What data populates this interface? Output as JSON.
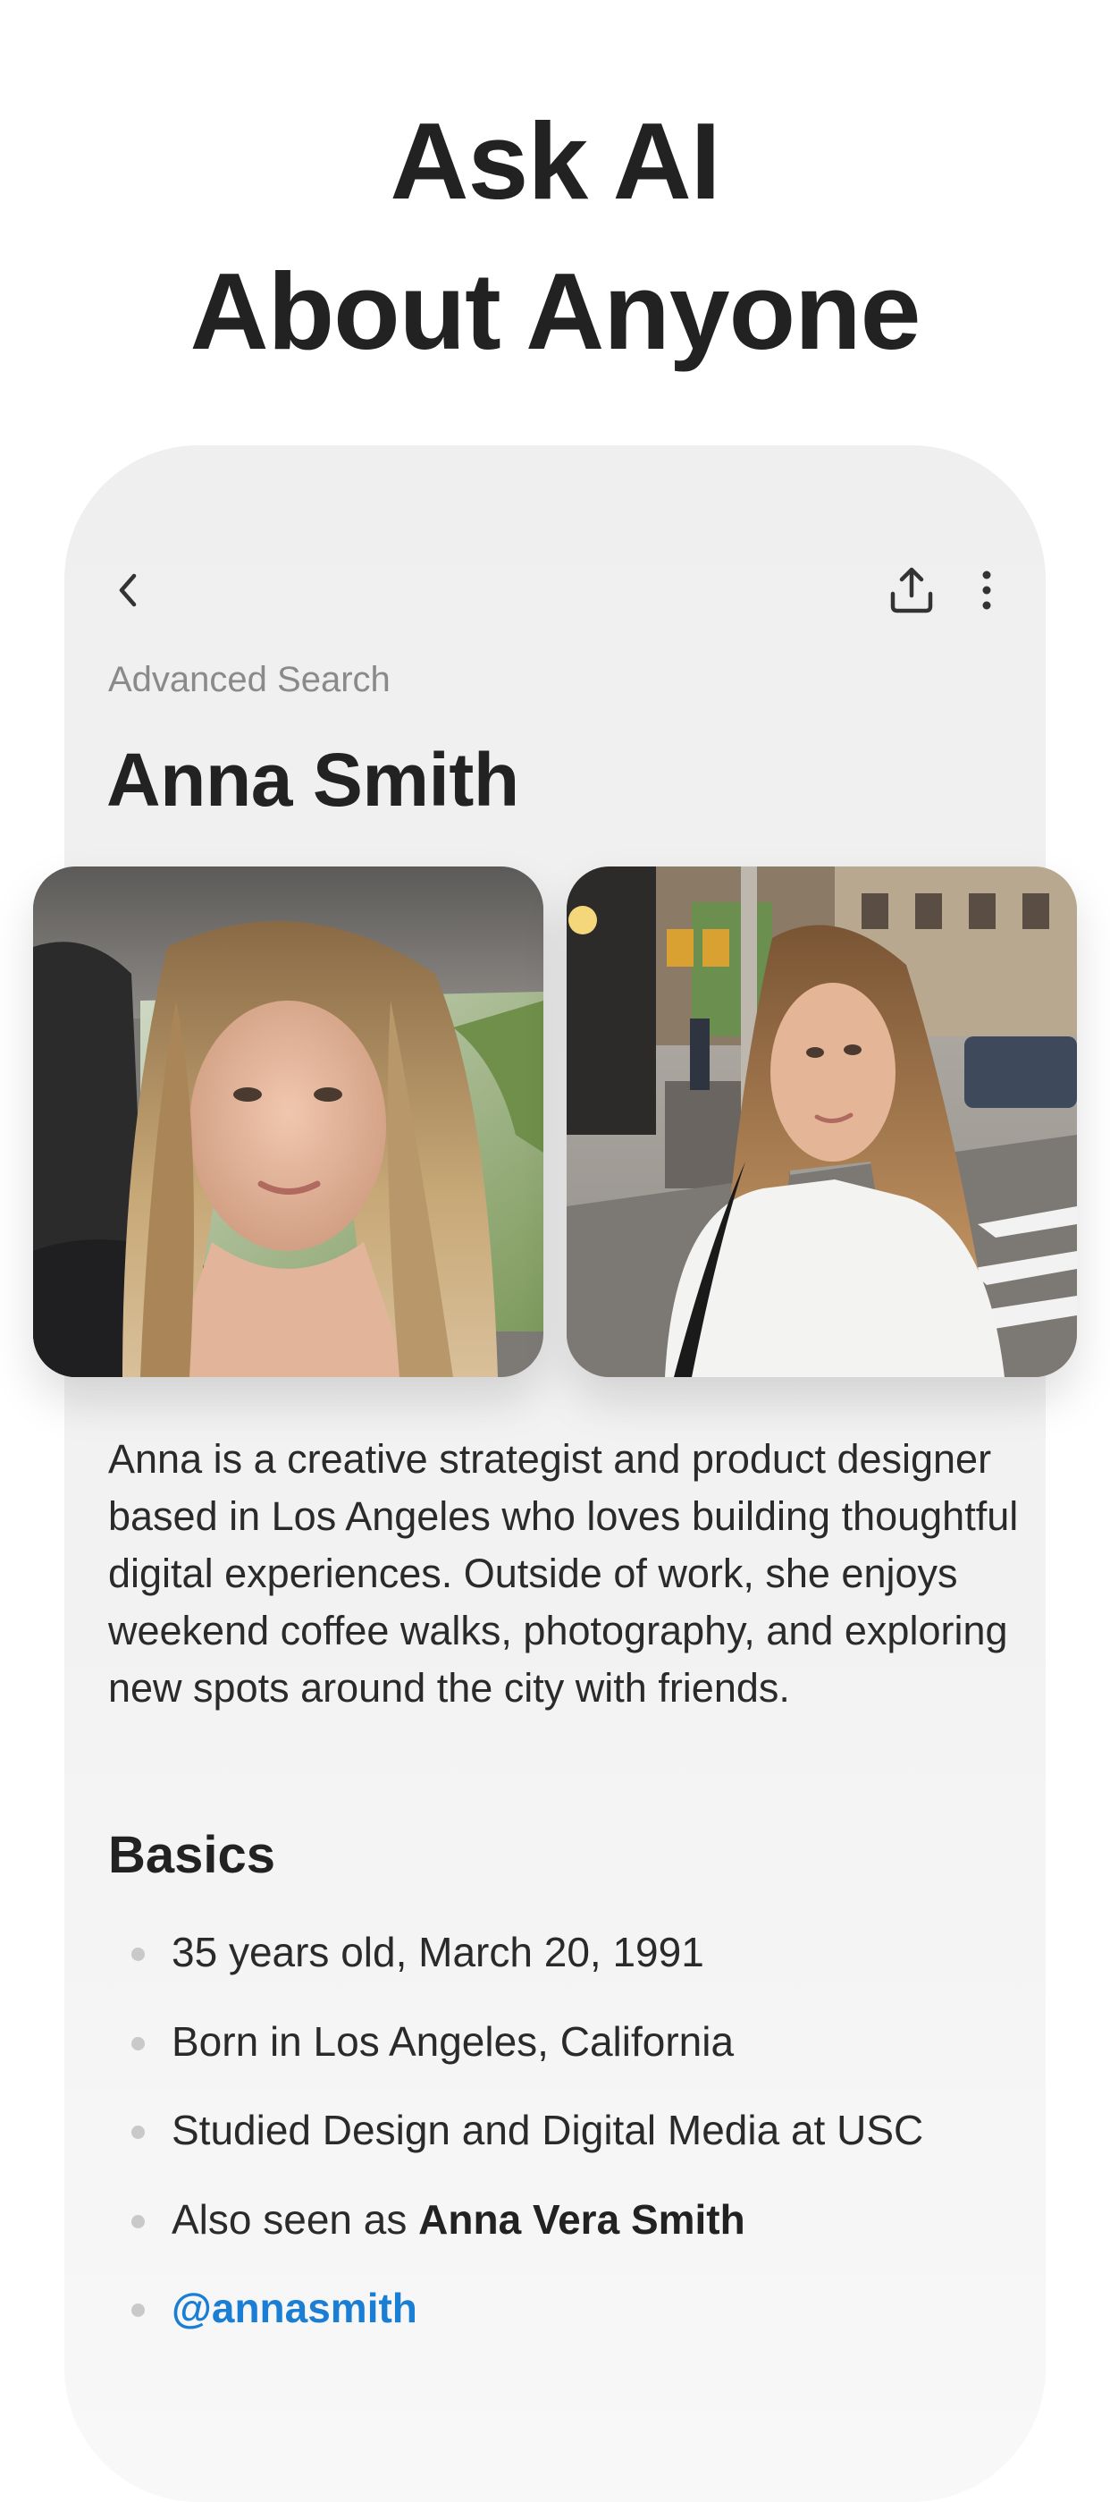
{
  "headline": {
    "line1": "Ask AI",
    "line2": "About Anyone"
  },
  "toolbar": {
    "back_icon": "chevron-left-icon",
    "share_icon": "share-upload-icon",
    "more_icon": "more-vertical-icon"
  },
  "breadcrumb": "Advanced Search",
  "profile": {
    "name": "Anna Smith",
    "photos": [
      "selfie-in-car-photo",
      "street-crosswalk-photo"
    ],
    "bio": "Anna is a creative strategist and product designer based in Los Angeles who loves building thoughtful digital experiences. Outside of work, she enjoys weekend coffee walks, photography, and exploring new spots around the city with friends."
  },
  "basics": {
    "heading": "Basics",
    "age": "35 years old, March 20, 1991",
    "born": "Born in Los Angeles, California",
    "studied": "Studied Design and Digital Media at USC",
    "alias_prefix": "Also seen as ",
    "alias_name": "Anna Vera Smith",
    "handle": "@annasmith"
  },
  "colors": {
    "card_background": "#efefef",
    "link": "#1a7fd4",
    "text": "#222222",
    "muted": "#8a8a8a"
  }
}
